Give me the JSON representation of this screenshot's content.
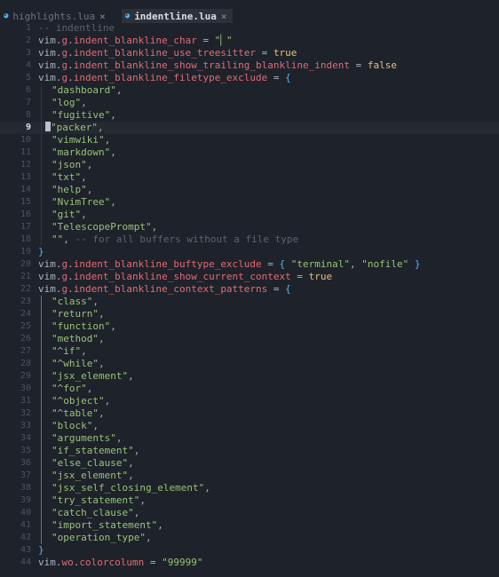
{
  "tabs": [
    {
      "icon": "lua-file-icon",
      "label": "highlights.lua",
      "active": false
    },
    {
      "icon": "lua-file-icon",
      "label": "indentline.lua",
      "active": true
    }
  ],
  "close_glyph": "×",
  "cursor_line": 9,
  "colors": {
    "background": "#1e222a",
    "field": "#e06c75",
    "string": "#98c379",
    "boolean": "#e5c07b",
    "comment": "#5c6370",
    "brace": "#61afef",
    "tab_active_bg": "#2c313a"
  },
  "lines": [
    {
      "n": "1",
      "tokens": [
        [
          "t-cmt",
          "-- indentline"
        ]
      ]
    },
    {
      "n": "2",
      "tokens": [
        [
          "t-var",
          "vim"
        ],
        [
          "t-punc",
          "."
        ],
        [
          "t-field",
          "g"
        ],
        [
          "t-punc",
          "."
        ],
        [
          "t-field",
          "indent_blankline_char"
        ],
        [
          "t-op",
          " = "
        ],
        [
          "t-str",
          "\"▏\""
        ]
      ]
    },
    {
      "n": "3",
      "tokens": [
        [
          "t-var",
          "vim"
        ],
        [
          "t-punc",
          "."
        ],
        [
          "t-field",
          "g"
        ],
        [
          "t-punc",
          "."
        ],
        [
          "t-field",
          "indent_blankline_use_treesitter"
        ],
        [
          "t-op",
          " = "
        ],
        [
          "t-bool",
          "true"
        ]
      ]
    },
    {
      "n": "4",
      "tokens": [
        [
          "t-var",
          "vim"
        ],
        [
          "t-punc",
          "."
        ],
        [
          "t-field",
          "g"
        ],
        [
          "t-punc",
          "."
        ],
        [
          "t-field",
          "indent_blankline_show_trailing_blankline_indent"
        ],
        [
          "t-op",
          " = "
        ],
        [
          "t-bool",
          "false"
        ]
      ]
    },
    {
      "n": "5",
      "tokens": [
        [
          "t-var",
          "vim"
        ],
        [
          "t-punc",
          "."
        ],
        [
          "t-field",
          "g"
        ],
        [
          "t-punc",
          "."
        ],
        [
          "t-field",
          "indent_blankline_filetype_exclude"
        ],
        [
          "t-op",
          " = "
        ],
        [
          "t-brace",
          "{"
        ]
      ]
    },
    {
      "n": "6",
      "indent": true,
      "tokens": [
        [
          "t-str",
          "\"dashboard\""
        ],
        [
          "t-punc",
          ","
        ]
      ]
    },
    {
      "n": "7",
      "indent": true,
      "tokens": [
        [
          "t-str",
          "\"log\""
        ],
        [
          "t-punc",
          ","
        ]
      ]
    },
    {
      "n": "8",
      "indent": true,
      "tokens": [
        [
          "t-str",
          "\"fugitive\""
        ],
        [
          "t-punc",
          ","
        ]
      ]
    },
    {
      "n": "9",
      "indent": true,
      "cursor": true,
      "tokens": [
        [
          "t-str",
          "\"packer\""
        ],
        [
          "t-punc",
          ","
        ]
      ]
    },
    {
      "n": "10",
      "indent": true,
      "tokens": [
        [
          "t-str",
          "\"vimwiki\""
        ],
        [
          "t-punc",
          ","
        ]
      ]
    },
    {
      "n": "11",
      "indent": true,
      "tokens": [
        [
          "t-str",
          "\"markdown\""
        ],
        [
          "t-punc",
          ","
        ]
      ]
    },
    {
      "n": "12",
      "indent": true,
      "tokens": [
        [
          "t-str",
          "\"json\""
        ],
        [
          "t-punc",
          ","
        ]
      ]
    },
    {
      "n": "13",
      "indent": true,
      "tokens": [
        [
          "t-str",
          "\"txt\""
        ],
        [
          "t-punc",
          ","
        ]
      ]
    },
    {
      "n": "14",
      "indent": true,
      "tokens": [
        [
          "t-str",
          "\"help\""
        ],
        [
          "t-punc",
          ","
        ]
      ]
    },
    {
      "n": "15",
      "indent": true,
      "tokens": [
        [
          "t-str",
          "\"NvimTree\""
        ],
        [
          "t-punc",
          ","
        ]
      ]
    },
    {
      "n": "16",
      "indent": true,
      "tokens": [
        [
          "t-str",
          "\"git\""
        ],
        [
          "t-punc",
          ","
        ]
      ]
    },
    {
      "n": "17",
      "indent": true,
      "tokens": [
        [
          "t-str",
          "\"TelescopePrompt\""
        ],
        [
          "t-punc",
          ","
        ]
      ]
    },
    {
      "n": "18",
      "indent": true,
      "tokens": [
        [
          "t-str",
          "\"\""
        ],
        [
          "t-punc",
          ", "
        ],
        [
          "t-cmt",
          "-- for all buffers without a file type"
        ]
      ]
    },
    {
      "n": "19",
      "tokens": [
        [
          "t-brace",
          "}"
        ]
      ]
    },
    {
      "n": "20",
      "tokens": [
        [
          "t-var",
          "vim"
        ],
        [
          "t-punc",
          "."
        ],
        [
          "t-field",
          "g"
        ],
        [
          "t-punc",
          "."
        ],
        [
          "t-field",
          "indent_blankline_buftype_exclude"
        ],
        [
          "t-op",
          " = "
        ],
        [
          "t-brace",
          "{ "
        ],
        [
          "t-str",
          "\"terminal\""
        ],
        [
          "t-punc",
          ", "
        ],
        [
          "t-str",
          "\"nofile\""
        ],
        [
          "t-brace",
          " }"
        ]
      ]
    },
    {
      "n": "21",
      "tokens": [
        [
          "t-var",
          "vim"
        ],
        [
          "t-punc",
          "."
        ],
        [
          "t-field",
          "g"
        ],
        [
          "t-punc",
          "."
        ],
        [
          "t-field",
          "indent_blankline_show_current_context"
        ],
        [
          "t-op",
          " = "
        ],
        [
          "t-bool",
          "true"
        ]
      ]
    },
    {
      "n": "22",
      "tokens": [
        [
          "t-var",
          "vim"
        ],
        [
          "t-punc",
          "."
        ],
        [
          "t-field",
          "g"
        ],
        [
          "t-punc",
          "."
        ],
        [
          "t-field",
          "indent_blankline_context_patterns"
        ],
        [
          "t-op",
          " = "
        ],
        [
          "t-brace",
          "{"
        ]
      ]
    },
    {
      "n": "23",
      "indent": true,
      "ctx": true,
      "tokens": [
        [
          "t-str",
          "\"class\""
        ],
        [
          "t-punc",
          ","
        ]
      ]
    },
    {
      "n": "24",
      "indent": true,
      "ctx": true,
      "tokens": [
        [
          "t-str",
          "\"return\""
        ],
        [
          "t-punc",
          ","
        ]
      ]
    },
    {
      "n": "25",
      "indent": true,
      "ctx": true,
      "tokens": [
        [
          "t-str",
          "\"function\""
        ],
        [
          "t-punc",
          ","
        ]
      ]
    },
    {
      "n": "26",
      "indent": true,
      "ctx": true,
      "tokens": [
        [
          "t-str",
          "\"method\""
        ],
        [
          "t-punc",
          ","
        ]
      ]
    },
    {
      "n": "27",
      "indent": true,
      "ctx": true,
      "tokens": [
        [
          "t-str",
          "\"^if\""
        ],
        [
          "t-punc",
          ","
        ]
      ]
    },
    {
      "n": "28",
      "indent": true,
      "ctx": true,
      "tokens": [
        [
          "t-str",
          "\"^while\""
        ],
        [
          "t-punc",
          ","
        ]
      ]
    },
    {
      "n": "29",
      "indent": true,
      "ctx": true,
      "tokens": [
        [
          "t-str",
          "\"jsx_element\""
        ],
        [
          "t-punc",
          ","
        ]
      ]
    },
    {
      "n": "30",
      "indent": true,
      "ctx": true,
      "tokens": [
        [
          "t-str",
          "\"^for\""
        ],
        [
          "t-punc",
          ","
        ]
      ]
    },
    {
      "n": "31",
      "indent": true,
      "ctx": true,
      "tokens": [
        [
          "t-str",
          "\"^object\""
        ],
        [
          "t-punc",
          ","
        ]
      ]
    },
    {
      "n": "32",
      "indent": true,
      "ctx": true,
      "tokens": [
        [
          "t-str",
          "\"^table\""
        ],
        [
          "t-punc",
          ","
        ]
      ]
    },
    {
      "n": "33",
      "indent": true,
      "ctx": true,
      "tokens": [
        [
          "t-str",
          "\"block\""
        ],
        [
          "t-punc",
          ","
        ]
      ]
    },
    {
      "n": "34",
      "indent": true,
      "ctx": true,
      "tokens": [
        [
          "t-str",
          "\"arguments\""
        ],
        [
          "t-punc",
          ","
        ]
      ]
    },
    {
      "n": "35",
      "indent": true,
      "ctx": true,
      "tokens": [
        [
          "t-str",
          "\"if_statement\""
        ],
        [
          "t-punc",
          ","
        ]
      ]
    },
    {
      "n": "36",
      "indent": true,
      "ctx": true,
      "tokens": [
        [
          "t-str",
          "\"else_clause\""
        ],
        [
          "t-punc",
          ","
        ]
      ]
    },
    {
      "n": "37",
      "indent": true,
      "ctx": true,
      "tokens": [
        [
          "t-str",
          "\"jsx_element\""
        ],
        [
          "t-punc",
          ","
        ]
      ]
    },
    {
      "n": "38",
      "indent": true,
      "ctx": true,
      "tokens": [
        [
          "t-str",
          "\"jsx_self_closing_element\""
        ],
        [
          "t-punc",
          ","
        ]
      ]
    },
    {
      "n": "39",
      "indent": true,
      "ctx": true,
      "tokens": [
        [
          "t-str",
          "\"try_statement\""
        ],
        [
          "t-punc",
          ","
        ]
      ]
    },
    {
      "n": "40",
      "indent": true,
      "ctx": true,
      "tokens": [
        [
          "t-str",
          "\"catch_clause\""
        ],
        [
          "t-punc",
          ","
        ]
      ]
    },
    {
      "n": "41",
      "indent": true,
      "ctx": true,
      "tokens": [
        [
          "t-str",
          "\"import_statement\""
        ],
        [
          "t-punc",
          ","
        ]
      ]
    },
    {
      "n": "42",
      "indent": true,
      "ctx": true,
      "tokens": [
        [
          "t-str",
          "\"operation_type\""
        ],
        [
          "t-punc",
          ","
        ]
      ]
    },
    {
      "n": "43",
      "tokens": [
        [
          "t-brace",
          "}"
        ]
      ]
    },
    {
      "n": "44",
      "tokens": [
        [
          "t-var",
          "vim"
        ],
        [
          "t-punc",
          "."
        ],
        [
          "t-field",
          "wo"
        ],
        [
          "t-punc",
          "."
        ],
        [
          "t-field",
          "colorcolumn"
        ],
        [
          "t-op",
          " = "
        ],
        [
          "t-str",
          "\"99999\""
        ]
      ]
    }
  ]
}
